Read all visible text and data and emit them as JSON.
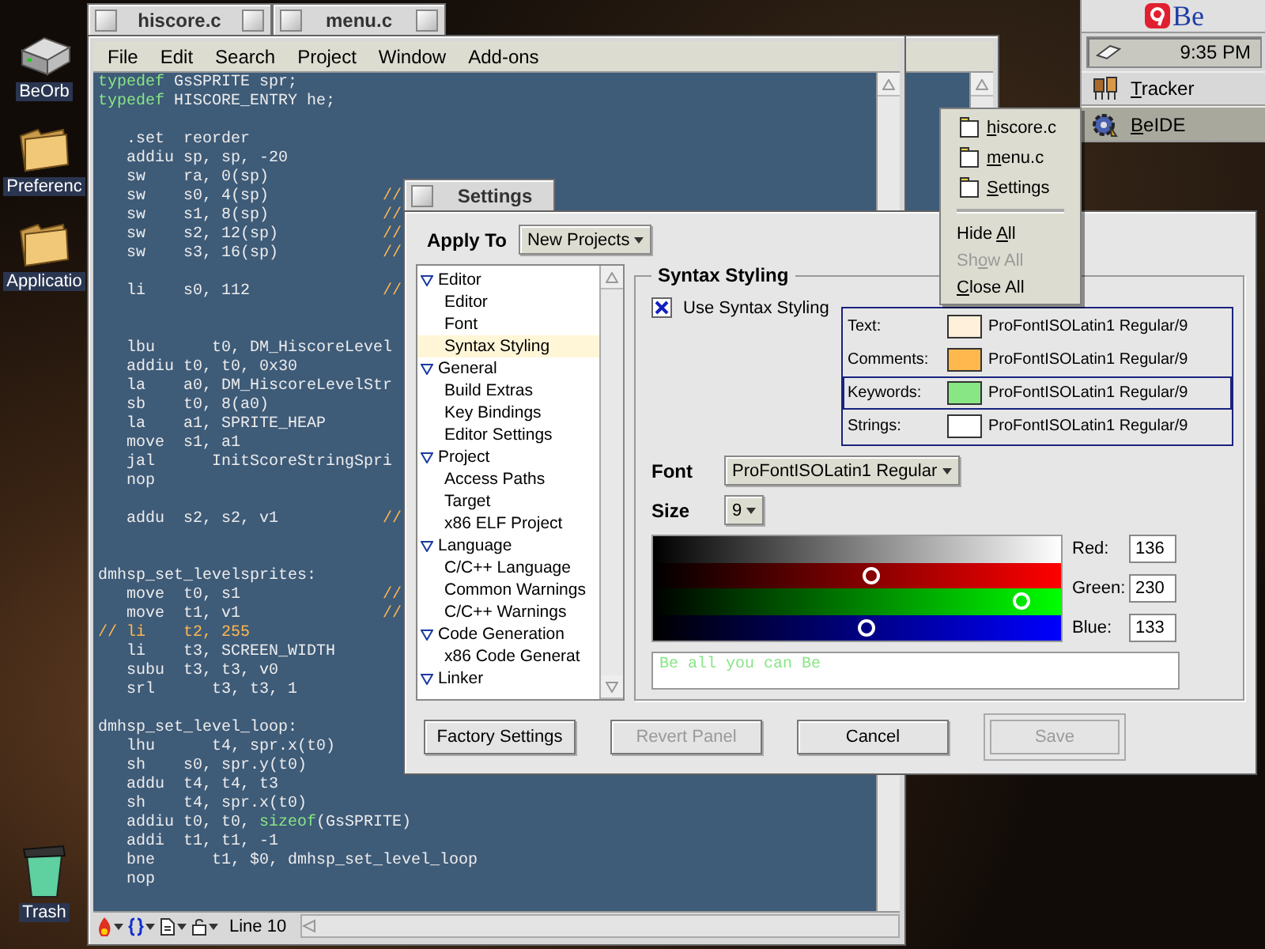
{
  "desktop_icons": [
    {
      "label": "BeOrb"
    },
    {
      "label": "Preferenc"
    },
    {
      "label": "Applicatio"
    },
    {
      "label": "Trash"
    }
  ],
  "menu_window": {
    "title": "menu.c"
  },
  "editor_window": {
    "title": "hiscore.c",
    "menu": [
      "File",
      "Edit",
      "Search",
      "Project",
      "Window",
      "Add-ons"
    ],
    "lines": [
      {
        "kind": "code",
        "parts": [
          {
            "kind": "keyword",
            "text": "typedef"
          },
          {
            "kind": "plain",
            "text": " GsSPRITE spr;"
          }
        ]
      },
      {
        "kind": "code",
        "parts": [
          {
            "kind": "keyword",
            "text": "typedef"
          },
          {
            "kind": "plain",
            "text": " HISCORE_ENTRY he;"
          }
        ]
      },
      {
        "kind": "blank"
      },
      {
        "kind": "code",
        "parts": [
          {
            "kind": "plain",
            "text": "   .set  reorder"
          }
        ]
      },
      {
        "kind": "code",
        "parts": [
          {
            "kind": "plain",
            "text": "   addiu sp, sp, -20"
          }
        ]
      },
      {
        "kind": "code",
        "parts": [
          {
            "kind": "plain",
            "text": "   sw    ra, 0(sp)"
          }
        ]
      },
      {
        "kind": "code",
        "parts": [
          {
            "kind": "plain",
            "text": "   sw    s0, 4(sp)            "
          },
          {
            "kind": "comment",
            "text": "//"
          }
        ]
      },
      {
        "kind": "code",
        "parts": [
          {
            "kind": "plain",
            "text": "   sw    s1, 8(sp)            "
          },
          {
            "kind": "comment",
            "text": "//"
          }
        ]
      },
      {
        "kind": "code",
        "parts": [
          {
            "kind": "plain",
            "text": "   sw    s2, 12(sp)           "
          },
          {
            "kind": "comment",
            "text": "//"
          }
        ]
      },
      {
        "kind": "code",
        "parts": [
          {
            "kind": "plain",
            "text": "   sw    s3, 16(sp)           "
          },
          {
            "kind": "comment",
            "text": "//"
          }
        ]
      },
      {
        "kind": "blank"
      },
      {
        "kind": "code",
        "parts": [
          {
            "kind": "plain",
            "text": "   li    s0, 112              "
          },
          {
            "kind": "comment",
            "text": "//"
          }
        ]
      },
      {
        "kind": "blank"
      },
      {
        "kind": "blank"
      },
      {
        "kind": "code",
        "parts": [
          {
            "kind": "plain",
            "text": "   lbu      t0, DM_HiscoreLevel"
          }
        ]
      },
      {
        "kind": "code",
        "parts": [
          {
            "kind": "plain",
            "text": "   addiu t0, t0, 0x30"
          }
        ]
      },
      {
        "kind": "code",
        "parts": [
          {
            "kind": "plain",
            "text": "   la    a0, DM_HiscoreLevelStr"
          }
        ]
      },
      {
        "kind": "code",
        "parts": [
          {
            "kind": "plain",
            "text": "   sb    t0, 8(a0)"
          }
        ]
      },
      {
        "kind": "code",
        "parts": [
          {
            "kind": "plain",
            "text": "   la    a1, SPRITE_HEAP"
          }
        ]
      },
      {
        "kind": "code",
        "parts": [
          {
            "kind": "plain",
            "text": "   move  s1, a1"
          }
        ]
      },
      {
        "kind": "code",
        "parts": [
          {
            "kind": "plain",
            "text": "   jal      InitScoreStringSpri"
          }
        ]
      },
      {
        "kind": "code",
        "parts": [
          {
            "kind": "plain",
            "text": "   nop"
          }
        ]
      },
      {
        "kind": "blank"
      },
      {
        "kind": "code",
        "parts": [
          {
            "kind": "plain",
            "text": "   addu  s2, s2, v1           "
          },
          {
            "kind": "comment",
            "text": "//"
          }
        ]
      },
      {
        "kind": "blank"
      },
      {
        "kind": "blank"
      },
      {
        "kind": "code",
        "parts": [
          {
            "kind": "plain",
            "text": "dmhsp_set_levelsprites:"
          }
        ]
      },
      {
        "kind": "code",
        "parts": [
          {
            "kind": "plain",
            "text": "   move  t0, s1               "
          },
          {
            "kind": "comment",
            "text": "//"
          }
        ]
      },
      {
        "kind": "code",
        "parts": [
          {
            "kind": "plain",
            "text": "   move  t1, v1               "
          },
          {
            "kind": "comment",
            "text": "//"
          }
        ]
      },
      {
        "kind": "code",
        "parts": [
          {
            "kind": "comment",
            "text": "// li    t2, 255"
          }
        ]
      },
      {
        "kind": "code",
        "parts": [
          {
            "kind": "plain",
            "text": "   li    t3, SCREEN_WIDTH"
          }
        ]
      },
      {
        "kind": "code",
        "parts": [
          {
            "kind": "plain",
            "text": "   subu  t3, t3, v0"
          }
        ]
      },
      {
        "kind": "code",
        "parts": [
          {
            "kind": "plain",
            "text": "   srl      t3, t3, 1"
          }
        ]
      },
      {
        "kind": "blank"
      },
      {
        "kind": "code",
        "parts": [
          {
            "kind": "plain",
            "text": "dmhsp_set_level_loop:"
          }
        ]
      },
      {
        "kind": "code",
        "parts": [
          {
            "kind": "plain",
            "text": "   lhu      t4, spr.x(t0)"
          }
        ]
      },
      {
        "kind": "code",
        "parts": [
          {
            "kind": "plain",
            "text": "   sh    s0, spr.y(t0)"
          }
        ]
      },
      {
        "kind": "code",
        "parts": [
          {
            "kind": "plain",
            "text": "   addu  t4, t4, t3"
          }
        ]
      },
      {
        "kind": "code",
        "parts": [
          {
            "kind": "plain",
            "text": "   sh    t4, spr.x(t0)"
          }
        ]
      },
      {
        "kind": "code",
        "parts": [
          {
            "kind": "plain",
            "text": "   addiu t0, t0, "
          },
          {
            "kind": "keyword",
            "text": "sizeof"
          },
          {
            "kind": "plain",
            "text": "(GsSPRITE)"
          }
        ]
      },
      {
        "kind": "code",
        "parts": [
          {
            "kind": "plain",
            "text": "   addi  t1, t1, -1"
          }
        ]
      },
      {
        "kind": "code",
        "parts": [
          {
            "kind": "plain",
            "text": "   bne      t1, $0, dmhsp_set_level_loop"
          }
        ]
      },
      {
        "kind": "code",
        "parts": [
          {
            "kind": "plain",
            "text": "   nop"
          }
        ]
      }
    ],
    "status": "Line 10"
  },
  "deskbar": {
    "logo": "Be",
    "clock": "9:35 PM",
    "apps": [
      {
        "key": "T",
        "post": "racker",
        "selected": false
      },
      {
        "key": "B",
        "post": "eIDE",
        "selected": true
      }
    ]
  },
  "window_menu": [
    {
      "kind": "window",
      "key": "h",
      "post": "iscore.c",
      "disabled": false
    },
    {
      "kind": "window",
      "key": "m",
      "post": "enu.c",
      "disabled": false
    },
    {
      "kind": "window",
      "key": "S",
      "post": "ettings",
      "disabled": false
    },
    {
      "kind": "separator"
    },
    {
      "kind": "command",
      "pre": "Hide ",
      "key": "A",
      "post": "ll",
      "disabled": false
    },
    {
      "kind": "command",
      "pre": "Sh",
      "key": "o",
      "post": "w All",
      "disabled": true
    },
    {
      "kind": "command",
      "key": "C",
      "post": "lose All",
      "disabled": false
    }
  ],
  "settings_window": {
    "title": "Settings",
    "apply_to": {
      "label": "Apply To",
      "value": "New Projects"
    },
    "tree": [
      {
        "label": "Editor",
        "expanded": true,
        "selected": false,
        "children": [
          {
            "label": "Editor",
            "selected": false
          },
          {
            "label": "Font",
            "selected": false
          },
          {
            "label": "Syntax Styling",
            "selected": true
          }
        ]
      },
      {
        "label": "General",
        "expanded": true,
        "selected": false,
        "children": [
          {
            "label": "Build Extras",
            "selected": false
          },
          {
            "label": "Key Bindings",
            "selected": false
          },
          {
            "label": "Editor Settings",
            "selected": false
          }
        ]
      },
      {
        "label": "Project",
        "expanded": true,
        "selected": false,
        "children": [
          {
            "label": "Access Paths",
            "selected": false
          },
          {
            "label": "Target",
            "selected": false
          },
          {
            "label": "x86 ELF Project",
            "selected": false
          }
        ]
      },
      {
        "label": "Language",
        "expanded": true,
        "selected": false,
        "children": [
          {
            "label": "C/C++ Language",
            "selected": false
          },
          {
            "label": "Common Warnings",
            "selected": false
          },
          {
            "label": "C/C++ Warnings",
            "selected": false
          }
        ]
      },
      {
        "label": "Code Generation",
        "expanded": true,
        "selected": false,
        "children": [
          {
            "label": "x86 Code Generat",
            "selected": false
          }
        ]
      },
      {
        "label": "Linker",
        "expanded": true,
        "selected": false
      }
    ],
    "panel": {
      "title": "Syntax Styling",
      "use_syntax": {
        "label": "Use Syntax Styling",
        "checked": true
      },
      "styles": [
        {
          "label": "Text:",
          "color": "#fff0dc",
          "font": "ProFontISOLatin1 Regular/9",
          "selected": false
        },
        {
          "label": "Comments:",
          "color": "#ffb84d",
          "font": "ProFontISOLatin1 Regular/9",
          "selected": false
        },
        {
          "label": "Keywords:",
          "color": "#88e685",
          "font": "ProFontISOLatin1 Regular/9",
          "selected": true
        },
        {
          "label": "Strings:",
          "color": "#ffffff",
          "font": "ProFontISOLatin1 Regular/9",
          "selected": false
        }
      ],
      "font": {
        "label": "Font",
        "value": "ProFontISOLatin1 Regular"
      },
      "size": {
        "label": "Size",
        "value": "9"
      },
      "channels": [
        {
          "name": "Red:",
          "value": "136",
          "level": 0.533
        },
        {
          "name": "Green:",
          "value": "230",
          "level": 0.902
        },
        {
          "name": "Blue:",
          "value": "133",
          "level": 0.522
        }
      ],
      "preview": "Be all you can Be"
    },
    "buttons": [
      {
        "label": "Factory Settings",
        "disabled": false,
        "default": false
      },
      {
        "label": "Revert Panel",
        "disabled": true,
        "default": false
      },
      {
        "label": "Cancel",
        "disabled": false,
        "default": false
      },
      {
        "label": "Save",
        "disabled": true,
        "default": true
      }
    ]
  }
}
